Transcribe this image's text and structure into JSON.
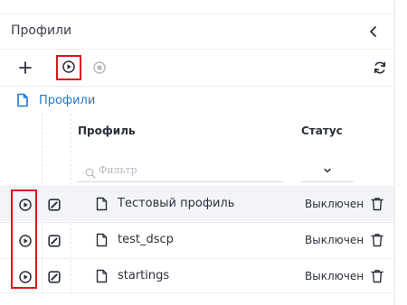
{
  "header": {
    "title": "Профили",
    "collapse_icon": "chevron-left-icon"
  },
  "toolbar": {
    "add_icon": "plus-icon",
    "start_icon": "play-circle-icon",
    "stop_icon": "stop-circle-icon",
    "refresh_icon": "refresh-icon"
  },
  "breadcrumb": {
    "label": "Профили",
    "icon": "file-icon"
  },
  "table": {
    "columns": {
      "profile": "Профиль",
      "status": "Статус"
    },
    "filter": {
      "placeholder": "Фильтр"
    },
    "rows": [
      {
        "name": "Тестовый профиль",
        "status": "Выключен"
      },
      {
        "name": "test_dscp",
        "status": "Выключен"
      },
      {
        "name": "startings",
        "status": "Выключен"
      }
    ]
  },
  "colors": {
    "accent": "#1f78d1",
    "highlight": "#e0161c",
    "selected_row": "#f2f4f8",
    "text": "#2b2f3a"
  }
}
